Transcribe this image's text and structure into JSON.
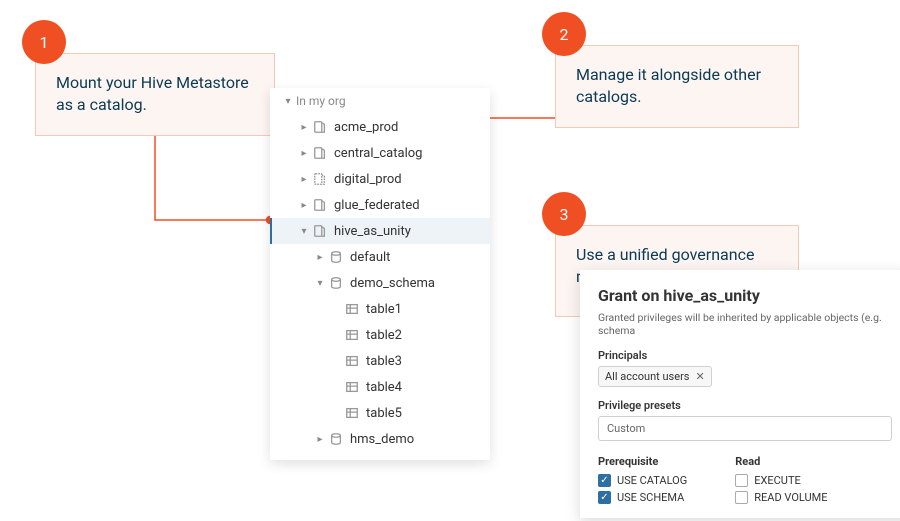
{
  "callouts": {
    "c1": {
      "num": "1",
      "text": "Mount your Hive Metastore as a catalog."
    },
    "c2": {
      "num": "2",
      "text": "Manage it alongside other catalogs."
    },
    "c3": {
      "num": "3",
      "text": "Use a unified governance model."
    }
  },
  "tree": {
    "root": "In my org",
    "items": {
      "acme_prod": "acme_prod",
      "central_catalog": "central_catalog",
      "digital_prod": "digital_prod",
      "glue_federated": "glue_federated",
      "hive_as_unity": "hive_as_unity",
      "default": "default",
      "demo_schema": "demo_schema",
      "table1": "table1",
      "table2": "table2",
      "table3": "table3",
      "table4": "table4",
      "table5": "table5",
      "hms_demo": "hms_demo"
    }
  },
  "grant": {
    "title": "Grant on hive_as_unity",
    "subtitle": "Granted privileges will be inherited by applicable objects (e.g. schema",
    "principals_label": "Principals",
    "principals_chip": "All account users",
    "presets_label": "Privilege presets",
    "presets_value": "Custom",
    "col_prereq": "Prerequisite",
    "col_read": "Read",
    "use_catalog": "USE CATALOG",
    "use_schema": "USE SCHEMA",
    "execute": "EXECUTE",
    "read_volume": "READ VOLUME"
  }
}
